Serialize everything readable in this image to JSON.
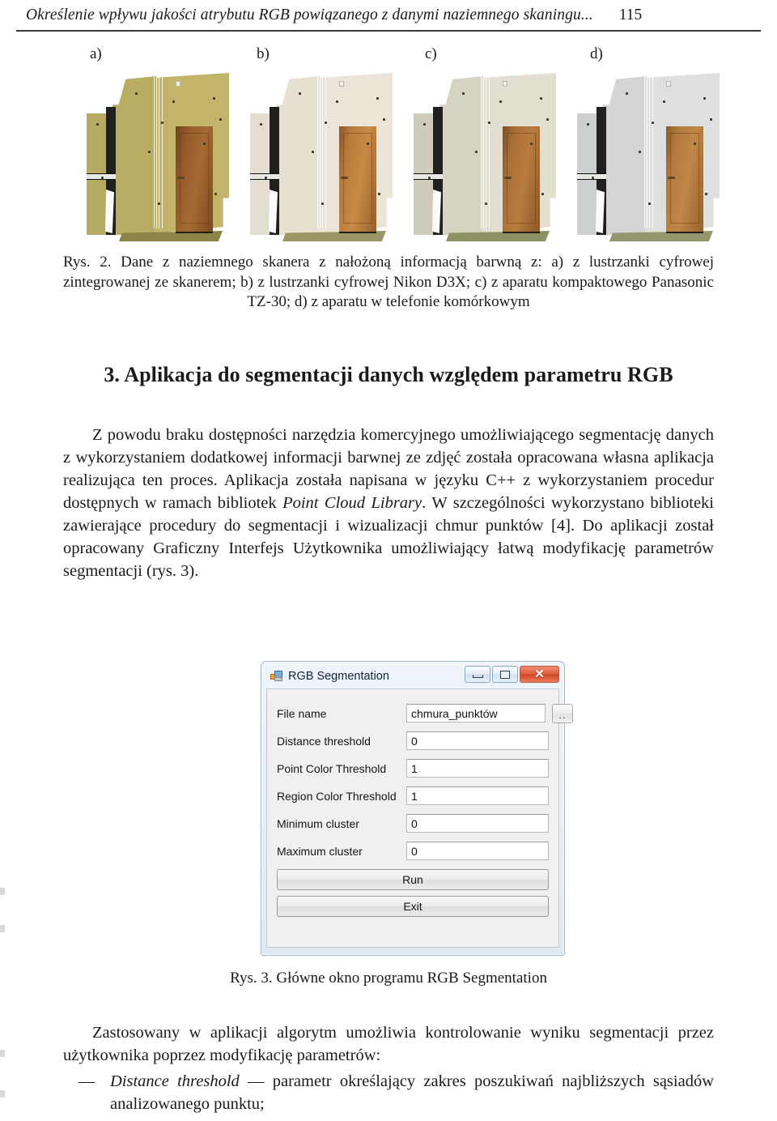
{
  "header": {
    "title": "Określenie wpływu jakości atrybutu RGB powiązanego z danymi naziemnego skaningu...",
    "page_number": "115"
  },
  "figure_2": {
    "panel_labels": [
      "a)",
      "b)",
      "c)",
      "d)"
    ],
    "caption": "Rys. 2. Dane z naziemnego skanera z nałożoną informacją barwną z: a) z lustrzanki cyfrowej zintegrowanej ze skanerem; b) z lustrzanki cyfrowej Nikon D3X; c) z aparatu kompaktowego Panasonic TZ-30; d) z aparatu w telefonie komórkowym"
  },
  "section": {
    "heading": "3. Aplikacja do segmentacji danych względem parametru RGB"
  },
  "paragraph_1": {
    "part_1": "Z powodu braku dostępności narzędzia komercyjnego umożliwiającego segmentację danych z wykorzystaniem dodatkowej informacji barwnej ze zdjęć została opracowana własna aplikacja realizująca ten proces. Aplikacja została napisana w języku C++ z wykorzystaniem procedur dostępnych w ramach bibliotek ",
    "italic_1": "Point Cloud Library",
    "part_2": ". W szczególności wykorzystano biblioteki zawierające procedury do segmentacji i wizualizacji chmur punktów [4]. Do aplikacji został opracowany Graficzny Interfejs Użytkownika umożliwiający łatwą modyfikację parametrów segmentacji (rys. 3)."
  },
  "dialog": {
    "title": "RGB Segmentation",
    "icon": "application-icon",
    "window_buttons": [
      {
        "name": "minimize",
        "glyph": "minimize-icon"
      },
      {
        "name": "maximize",
        "glyph": "maximize-icon"
      },
      {
        "name": "close",
        "glyph": "✕"
      }
    ],
    "fields": [
      {
        "label": "File name",
        "value": "chmura_punktów",
        "has_browse": true
      },
      {
        "label": "Distance threshold",
        "value": "0",
        "has_browse": false
      },
      {
        "label": "Point Color Threshold",
        "value": "1",
        "has_browse": false
      },
      {
        "label": "Region Color Threshold",
        "value": "1",
        "has_browse": false
      },
      {
        "label": "Minimum cluster",
        "value": "0",
        "has_browse": false
      },
      {
        "label": "Maximum cluster",
        "value": "0",
        "has_browse": false
      }
    ],
    "browse_label": "..",
    "buttons": [
      {
        "label": "Run"
      },
      {
        "label": "Exit"
      }
    ]
  },
  "figure_3": {
    "caption": "Rys. 3. Główne okno programu RGB Segmentation"
  },
  "paragraph_2": {
    "text": "Zastosowany w aplikacji algorytm umożliwia kontrolowanie wyniku segmentacji przez użytkownika poprzez modyfikację parametrów:"
  },
  "bullets": [
    {
      "dash": "—",
      "italic": "Distance threshold",
      "rest": " — parametr określający zakres poszukiwań najbliższych sąsiadów analizowanego punktu;"
    }
  ],
  "colors": {
    "page_background": "#ffffff",
    "text": "#1a1a1a",
    "dialog_title_text": "#11263d",
    "dialog_close_button": "#cf4326",
    "dialog_client_background": "#f0f0f0",
    "input_background": "#ffffff"
  }
}
